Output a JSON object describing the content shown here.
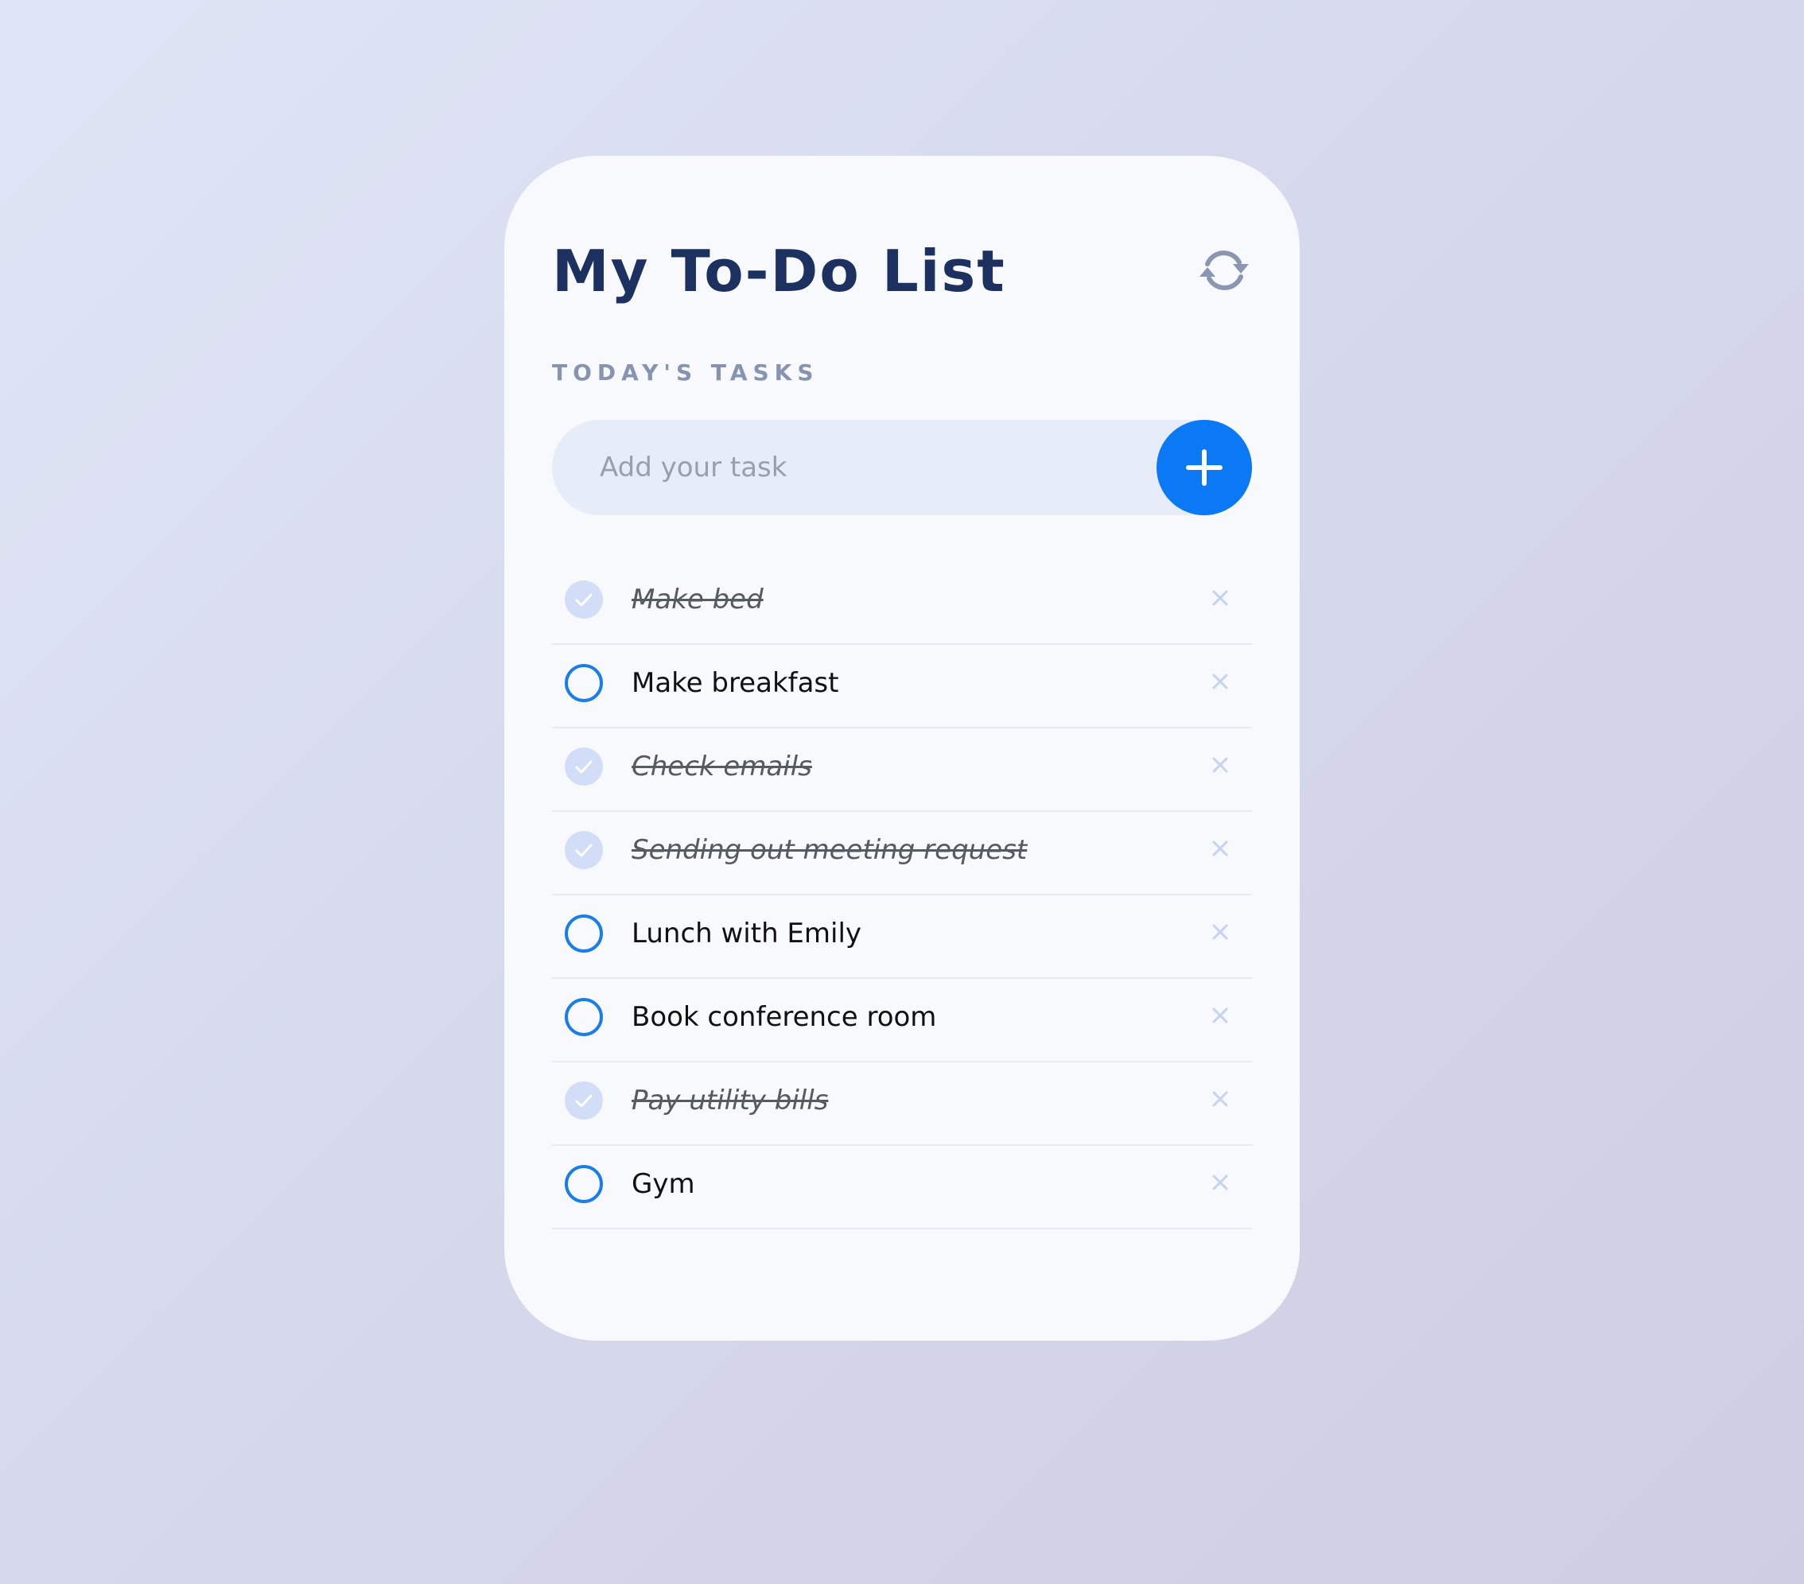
{
  "header": {
    "title": "My To-Do List",
    "refresh_icon": "refresh-icon"
  },
  "section": {
    "label": "TODAY'S TASKS"
  },
  "add_task": {
    "placeholder": "Add your task",
    "value": "",
    "button_icon": "plus-icon"
  },
  "tasks": [
    {
      "label": "Make bed",
      "done": true
    },
    {
      "label": "Make breakfast",
      "done": false
    },
    {
      "label": "Check emails",
      "done": true
    },
    {
      "label": "Sending out meeting request",
      "done": true
    },
    {
      "label": "Lunch with Emily",
      "done": false
    },
    {
      "label": "Book conference room",
      "done": false
    },
    {
      "label": "Pay utility bills",
      "done": true
    },
    {
      "label": "Gym",
      "done": false
    }
  ],
  "colors": {
    "accent": "#0b78f5",
    "title": "#1d3160",
    "subtitle": "#8794b0",
    "card_bg": "#f7f9fd",
    "input_bg": "#e7ecf9",
    "done_check_bg": "#d2def8",
    "delete_icon": "#c5d3f1"
  }
}
